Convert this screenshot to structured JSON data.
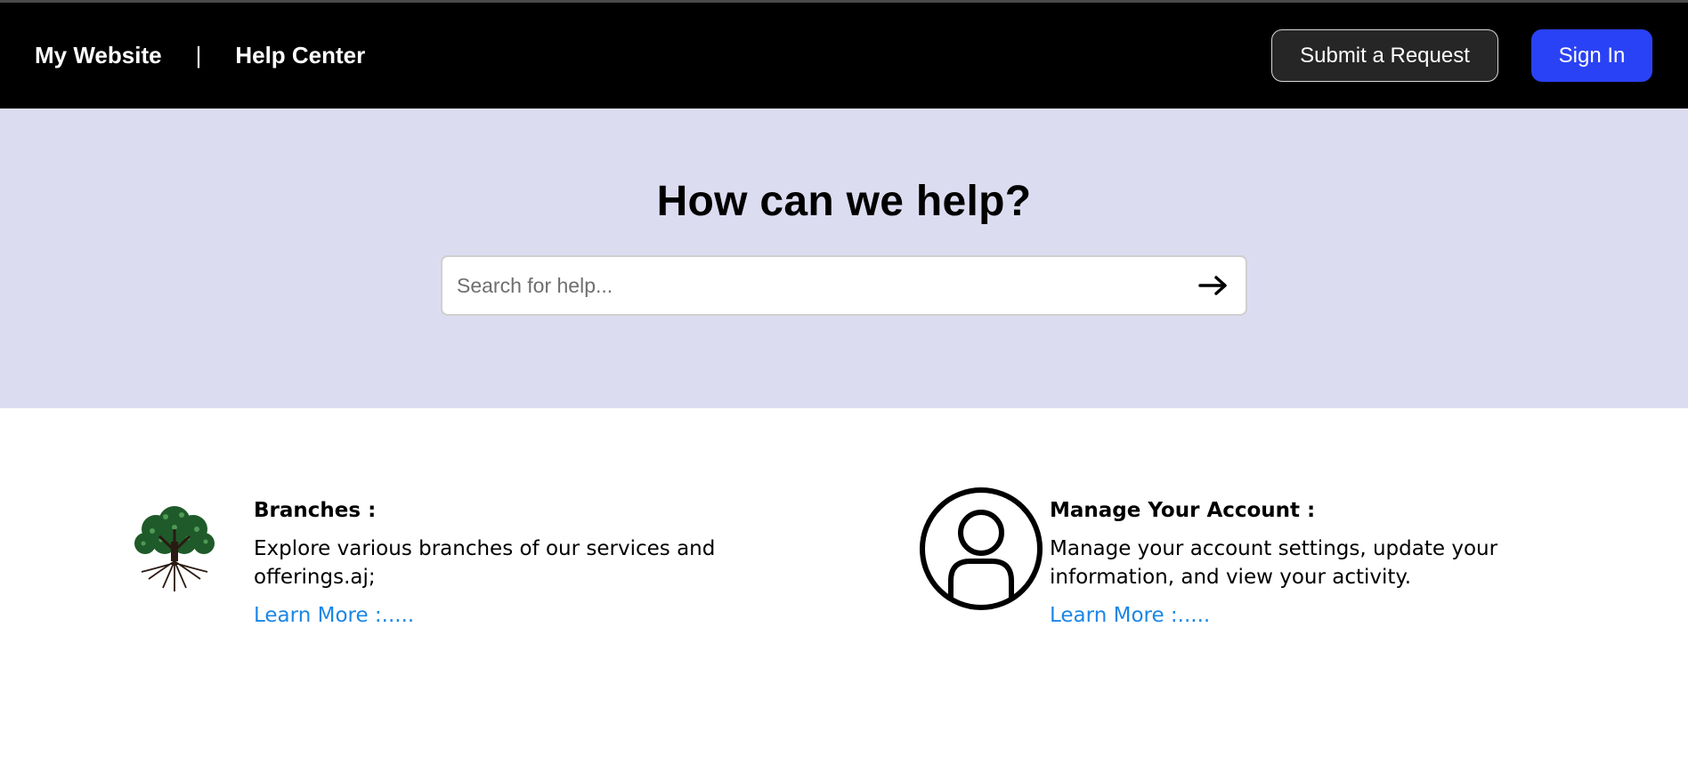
{
  "header": {
    "site_name": "My Website",
    "separator": "|",
    "section_name": "Help Center",
    "submit_request_label": "Submit a Request",
    "sign_in_label": "Sign In"
  },
  "hero": {
    "title": "How can we help?",
    "search_placeholder": "Search for help...",
    "search_icon": "arrow-right-icon"
  },
  "cards": [
    {
      "icon": "tree-icon",
      "title": "Branches :",
      "description": "Explore various branches of our services and offerings.aj;",
      "link": "Learn More :....."
    },
    {
      "icon": "user-circle-icon",
      "title": "Manage Your Account :",
      "description": "Manage your account settings, update your information, and view your activity.",
      "link": "Learn More :....."
    }
  ],
  "colors": {
    "navbar": "#000000",
    "hero_background": "#dcdcf1",
    "sign_in_button": "#2a42f5",
    "link": "#1a86e6"
  }
}
